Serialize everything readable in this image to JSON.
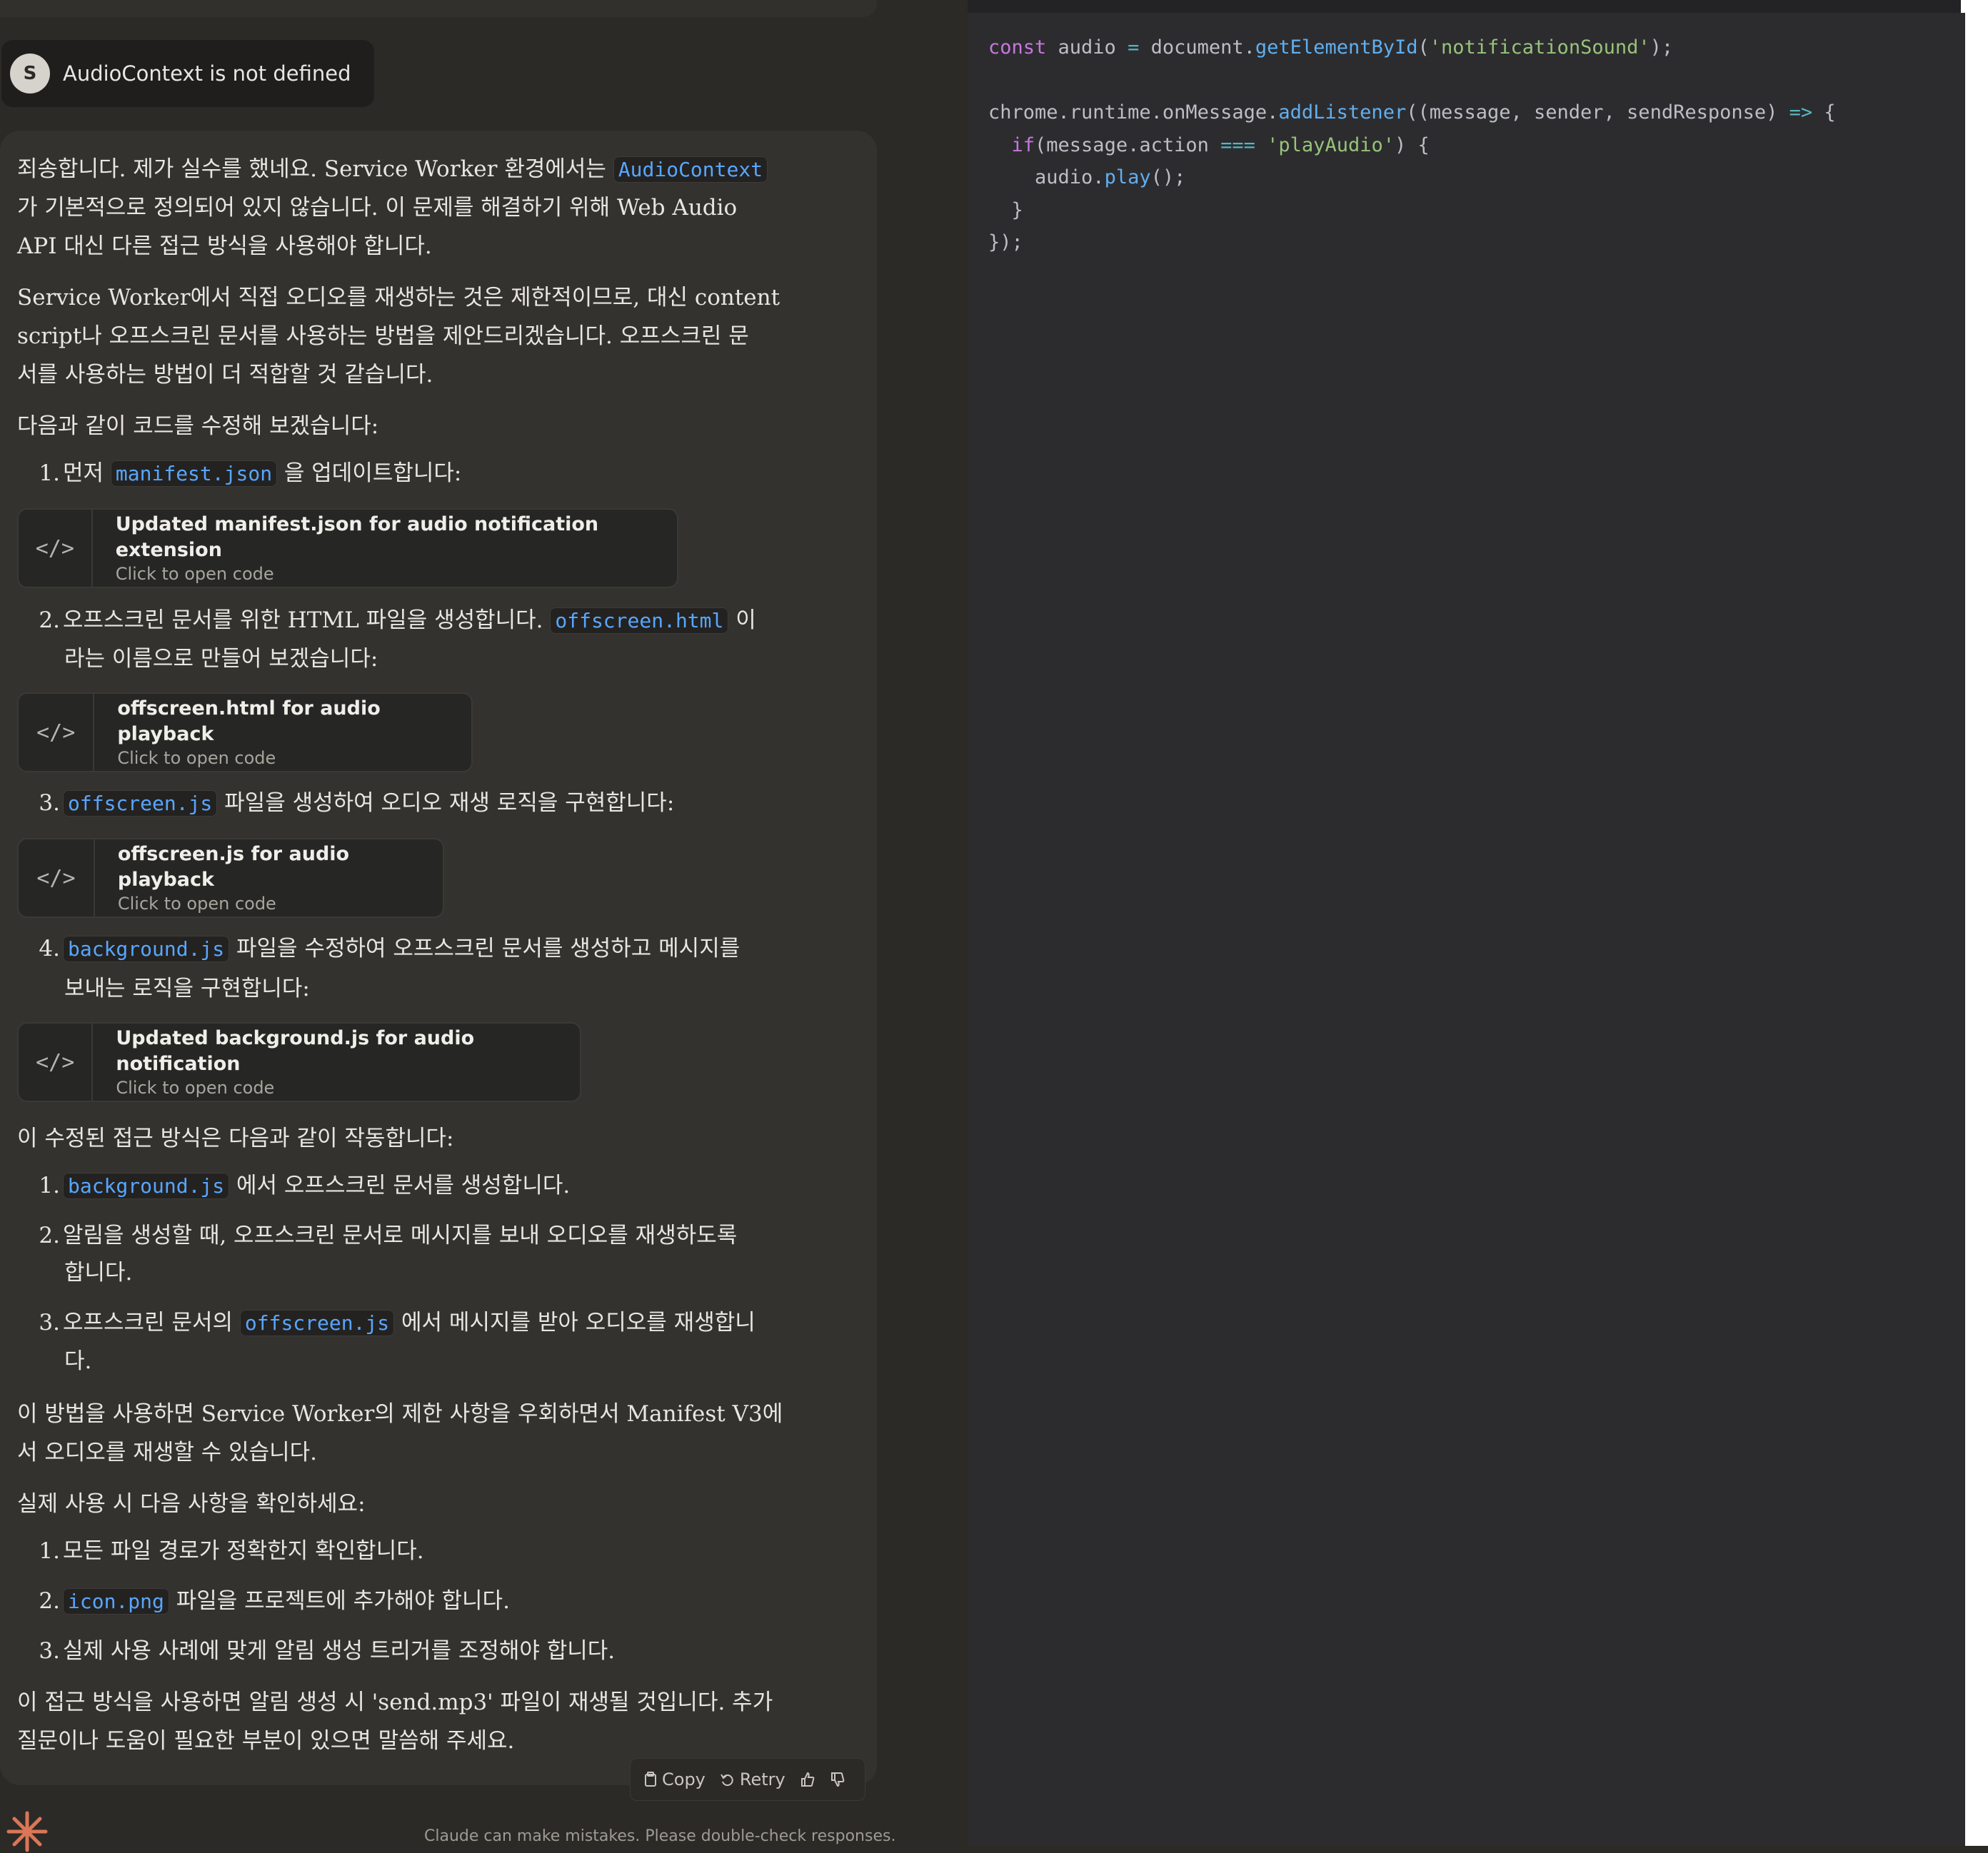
{
  "user_message": {
    "avatar_initial": "S",
    "text": "AudioContext is not defined"
  },
  "response": {
    "p1": {
      "l1_a": "죄송합니다. 제가 실수를 했네요. Service Worker 환경에서는 ",
      "l1_code": "AudioContext",
      "l2": "가 기본적으로 정의되어 있지 않습니다. 이 문제를 해결하기 위해 Web Audio",
      "l3": "API 대신 다른 접근 방식을 사용해야 합니다."
    },
    "p2": {
      "l1": "Service Worker에서 직접 오디오를 재생하는 것은 제한적이므로, 대신 content",
      "l2": "script나 오프스크린 문서를 사용하는 방법을 제안드리겠습니다. 오프스크린 문",
      "l3": "서를 사용하는 방법이 더 적합할 것 같습니다."
    },
    "p3": "다음과 같이 코드를 수정해 보겠습니다:",
    "steps": [
      {
        "num": "1.",
        "a": "먼저 ",
        "code": "manifest.json",
        "b": " 을 업데이트합니다:"
      },
      {
        "num": "2.",
        "a": "오프스크린 문서를 위한 HTML 파일을 생성합니다. ",
        "code": "offscreen.html",
        "b": " 이",
        "cont": "라는 이름으로 만들어 보겠습니다:"
      },
      {
        "num": "3.",
        "a": "",
        "code": "offscreen.js",
        "b": " 파일을 생성하여 오디오 재생 로직을 구현합니다:"
      },
      {
        "num": "4.",
        "a": "",
        "code": "background.js",
        "b": " 파일을 수정하여 오프스크린 문서를 생성하고 메시지를",
        "cont": "보내는 로직을 구현합니다:"
      }
    ],
    "artifacts": [
      {
        "title": "Updated manifest.json for audio notification extension",
        "subtitle": "Click to open code",
        "icon": "code-icon"
      },
      {
        "title": "offscreen.html for audio playback",
        "subtitle": "Click to open code",
        "icon": "code-icon"
      },
      {
        "title": "offscreen.js for audio playback",
        "subtitle": "Click to open code",
        "icon": "code-icon"
      },
      {
        "title": "Updated background.js for audio notification",
        "subtitle": "Click to open code",
        "icon": "code-icon"
      }
    ],
    "p4": "이 수정된 접근 방식은 다음과 같이 작동합니다:",
    "how": [
      {
        "num": "1.",
        "code": "background.js",
        "b": " 에서 오프스크린 문서를 생성합니다."
      },
      {
        "num": "2.",
        "a": "알림을 생성할 때, 오프스크린 문서로 메시지를 보내 오디오를 재생하도록",
        "cont": "합니다."
      },
      {
        "num": "3.",
        "a": "오프스크린 문서의 ",
        "code": "offscreen.js",
        "b": " 에서 메시지를 받아 오디오를 재생합니",
        "cont": "다."
      }
    ],
    "p5": {
      "l1": "이 방법을 사용하면 Service Worker의 제한 사항을 우회하면서 Manifest V3에",
      "l2": "서 오디오를 재생할 수 있습니다."
    },
    "p6": "실제 사용 시 다음 사항을 확인하세요:",
    "checks": [
      {
        "num": "1.",
        "a": "모든 파일 경로가 정확한지 확인합니다."
      },
      {
        "num": "2.",
        "code": "icon.png",
        "b": " 파일을 프로젝트에 추가해야 합니다."
      },
      {
        "num": "3.",
        "a": "실제 사용 사례에 맞게 알림 생성 트리거를 조정해야 합니다."
      }
    ],
    "p7": {
      "l1": "이 접근 방식을 사용하면 알림 생성 시 'send.mp3' 파일이 재생될 것입니다. 추가",
      "l2": "질문이나 도움이 필요한 부분이 있으면 말씀해 주세요."
    }
  },
  "actions": {
    "copy": "Copy",
    "retry": "Retry"
  },
  "disclaimer": "Claude can make mistakes. Please double-check responses.",
  "code_panel": {
    "lines": [
      [
        [
          "kw",
          "const"
        ],
        [
          "",
          "audio"
        ],
        [
          "op",
          "="
        ],
        [
          "",
          "document."
        ],
        [
          "fn",
          "getElementById"
        ],
        [
          "",
          "("
        ],
        [
          "str",
          "'notificationSound'"
        ],
        [
          "",
          ");"
        ]
      ],
      [],
      [
        [
          "",
          "chrome.runtime.onMessage."
        ],
        [
          "fn",
          "addListener"
        ],
        [
          "",
          "((message, sender, sendResponse)"
        ],
        [
          "op",
          "=>"
        ],
        [
          "",
          "{"
        ]
      ],
      [
        [
          "",
          "  "
        ],
        [
          "kw",
          "if"
        ],
        [
          "",
          "(message.action"
        ],
        [
          "op",
          "==="
        ],
        [
          "str",
          "'playAudio'"
        ],
        [
          "",
          ") {"
        ]
      ],
      [
        [
          "",
          "    audio."
        ],
        [
          "fn",
          "play"
        ],
        [
          "",
          "();"
        ]
      ],
      [
        [
          "",
          "  }"
        ]
      ],
      [
        [
          "",
          "});"
        ]
      ]
    ]
  }
}
